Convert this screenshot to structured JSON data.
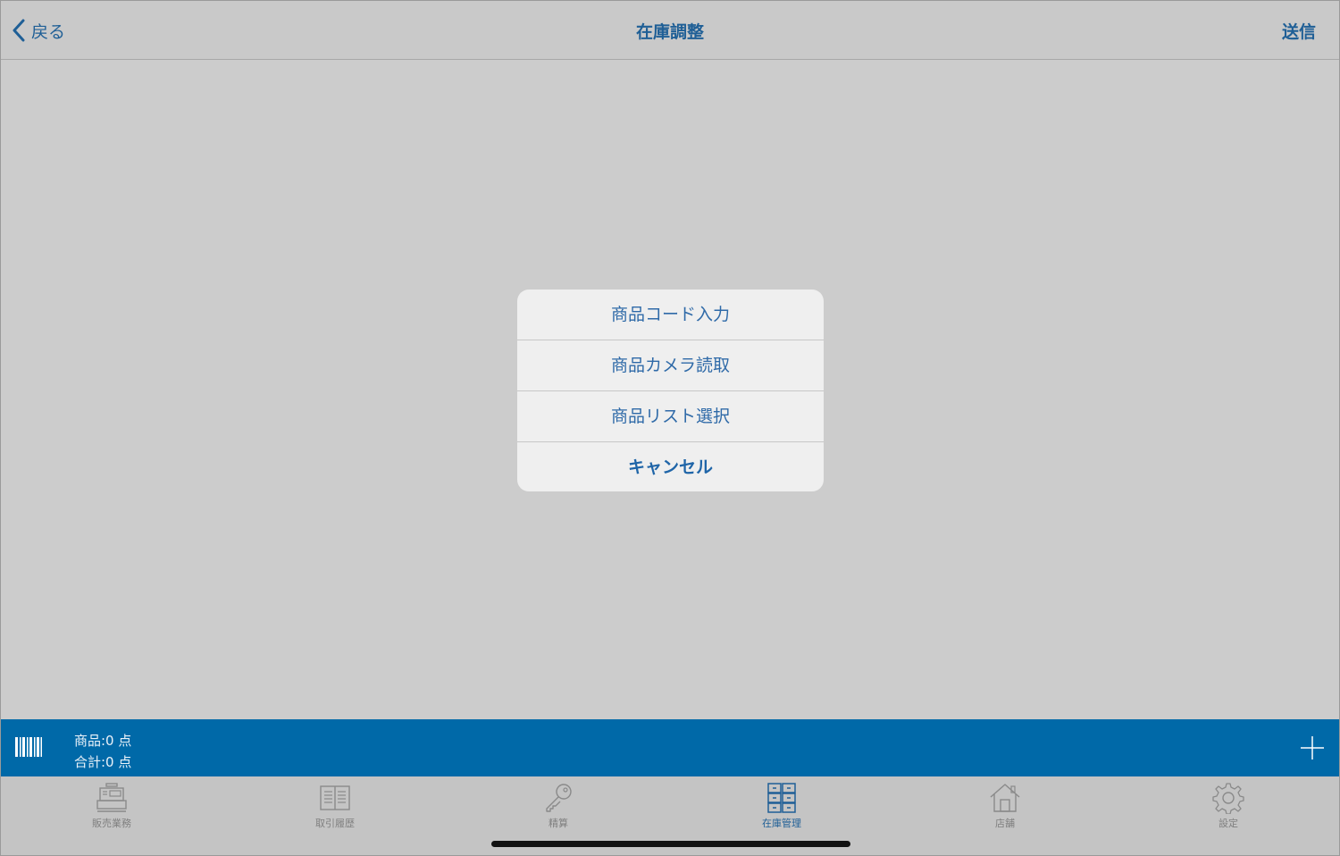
{
  "navbar": {
    "back_label": "戻る",
    "title": "在庫調整",
    "send_label": "送信"
  },
  "action_sheet": {
    "items": [
      {
        "label": "商品コード入力"
      },
      {
        "label": "商品カメラ読取"
      },
      {
        "label": "商品リスト選択"
      }
    ],
    "cancel_label": "キャンセル"
  },
  "status": {
    "items_line": "商品:0 点",
    "total_line": "合計:0 点"
  },
  "tabs": [
    {
      "label": "販売業務",
      "icon": "register-icon"
    },
    {
      "label": "取引履歴",
      "icon": "book-icon"
    },
    {
      "label": "精算",
      "icon": "key-icon"
    },
    {
      "label": "在庫管理",
      "icon": "inventory-icon",
      "active": true
    },
    {
      "label": "店舗",
      "icon": "store-icon"
    },
    {
      "label": "設定",
      "icon": "gear-icon"
    }
  ],
  "colors": {
    "accent": "#1f5f96",
    "statusbar": "#0069a8",
    "background": "#cccccc"
  }
}
